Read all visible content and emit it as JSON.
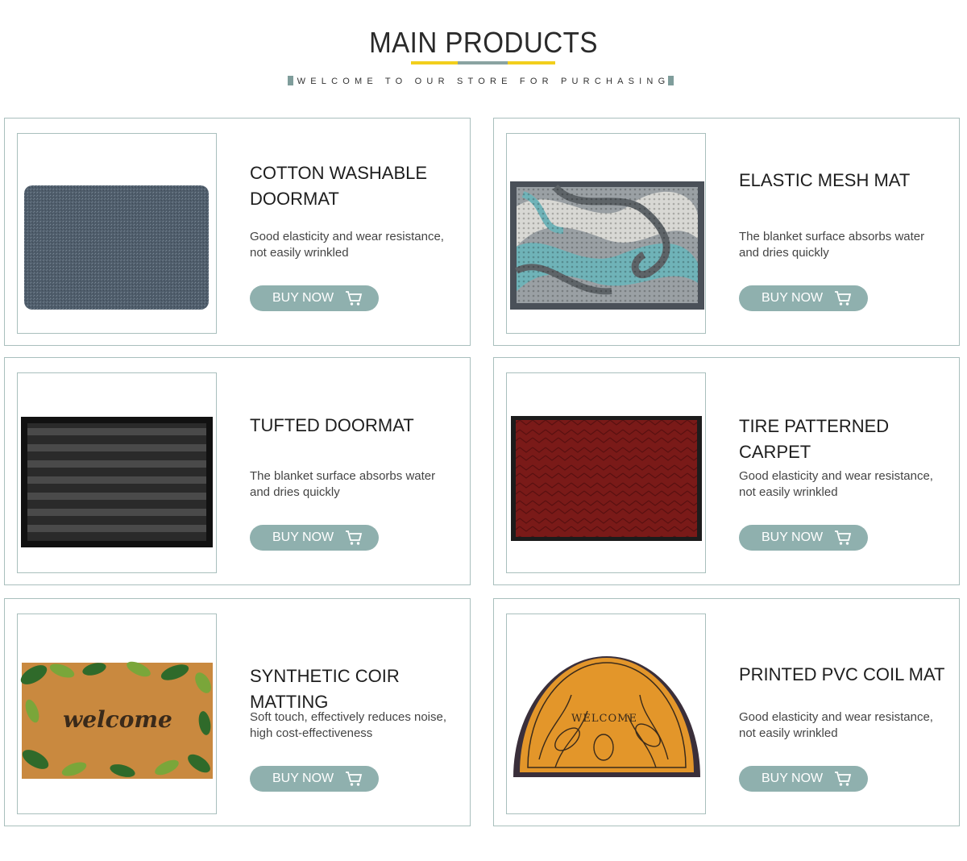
{
  "header": {
    "title": "MAIN PRODUCTS",
    "subtitle": "WELCOME TO OUR STORE FOR PURCHASING",
    "colors": {
      "accent_yellow": "#f2cf1c",
      "accent_gray": "#8aa3a1"
    }
  },
  "products": [
    {
      "title": "COTTON WASHABLE DOORMAT",
      "description": "Good elasticity and wear resistance, not easily wrinkled",
      "button": "BUY NOW",
      "image": "gray-cotton-doormat"
    },
    {
      "title": "ELASTIC MESH MAT",
      "description": "The blanket surface absorbs water and dries quickly",
      "button": "BUY NOW",
      "image": "wave-pattern-mesh-mat"
    },
    {
      "title": "TUFTED DOORMAT",
      "description": "The blanket surface absorbs water and dries quickly",
      "button": "BUY NOW",
      "image": "black-striped-tufted-mat"
    },
    {
      "title": "TIRE PATTERNED CARPET",
      "description": "Good elasticity and wear resistance, not easily wrinkled",
      "button": "BUY NOW",
      "image": "red-herringbone-carpet"
    },
    {
      "title": "SYNTHETIC COIR MATTING",
      "description": "Soft touch, effectively reduces noise, high cost-effectiveness",
      "button": "BUY NOW",
      "image": "welcome-coir-mat-leaves",
      "image_text": "welcome"
    },
    {
      "title": "PRINTED PVC COIL MAT",
      "description": "Good elasticity and wear resistance, not easily wrinkled",
      "button": "BUY NOW",
      "image": "half-round-welcome-mat",
      "image_text": "WELCOME"
    }
  ],
  "colors": {
    "button_bg": "#8fb0ae",
    "card_border": "#a9bfbd"
  },
  "icons": [
    "cart-icon"
  ]
}
